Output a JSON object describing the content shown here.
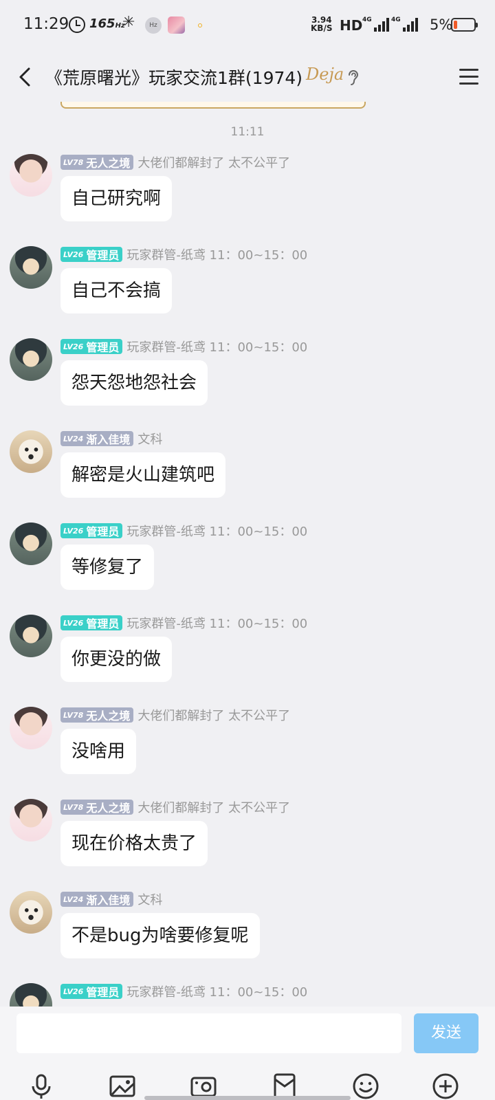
{
  "status_bar": {
    "time": "11:29",
    "refresh_rate": "165",
    "refresh_unit": "Hz",
    "hz_badge": "Hz",
    "net_speed_value": "3.94",
    "net_speed_unit": "KB/S",
    "hd_label": "HD",
    "signal1_label": "4G",
    "signal2_label": "4G",
    "battery_percent": "5%"
  },
  "header": {
    "title": "《荒原曙光》玩家交流1群(1974)",
    "brand_mark": "Deja"
  },
  "chat": {
    "time_separator": "11:11",
    "messages": [
      {
        "avatar": "boy",
        "level": "LV78",
        "badge": "无人之境",
        "badge_style": "gray",
        "nickname": "大佬们都解封了 太不公平了",
        "text": "自己研究啊"
      },
      {
        "avatar": "admin",
        "level": "LV26",
        "badge": "管理员",
        "badge_style": "teal",
        "nickname": "玩家群管-纸鸢 11：00~15：00",
        "text": "自己不会搞"
      },
      {
        "avatar": "admin",
        "level": "LV26",
        "badge": "管理员",
        "badge_style": "teal",
        "nickname": "玩家群管-纸鸢 11：00~15：00",
        "text": "怨天怨地怨社会"
      },
      {
        "avatar": "dog",
        "level": "LV24",
        "badge": "渐入佳境",
        "badge_style": "gray",
        "nickname": "文科",
        "text": "解密是火山建筑吧"
      },
      {
        "avatar": "admin",
        "level": "LV26",
        "badge": "管理员",
        "badge_style": "teal",
        "nickname": "玩家群管-纸鸢 11：00~15：00",
        "text": "等修复了"
      },
      {
        "avatar": "admin",
        "level": "LV26",
        "badge": "管理员",
        "badge_style": "teal",
        "nickname": "玩家群管-纸鸢 11：00~15：00",
        "text": "你更没的做"
      },
      {
        "avatar": "boy",
        "level": "LV78",
        "badge": "无人之境",
        "badge_style": "gray",
        "nickname": "大佬们都解封了 太不公平了",
        "text": "没啥用"
      },
      {
        "avatar": "boy",
        "level": "LV78",
        "badge": "无人之境",
        "badge_style": "gray",
        "nickname": "大佬们都解封了 太不公平了",
        "text": "现在价格太贵了"
      },
      {
        "avatar": "dog",
        "level": "LV24",
        "badge": "渐入佳境",
        "badge_style": "gray",
        "nickname": "文科",
        "text": "不是bug为啥要修复呢"
      },
      {
        "avatar": "admin",
        "level": "LV26",
        "badge": "管理员",
        "badge_style": "teal",
        "nickname": "玩家群管-纸鸢 11：00~15：00",
        "text": ""
      }
    ]
  },
  "composer": {
    "input_value": "",
    "send_label": "发送",
    "tools": [
      "microphone-icon",
      "image-icon",
      "camera-icon",
      "red-packet-icon",
      "emoji-icon",
      "plus-icon"
    ]
  }
}
